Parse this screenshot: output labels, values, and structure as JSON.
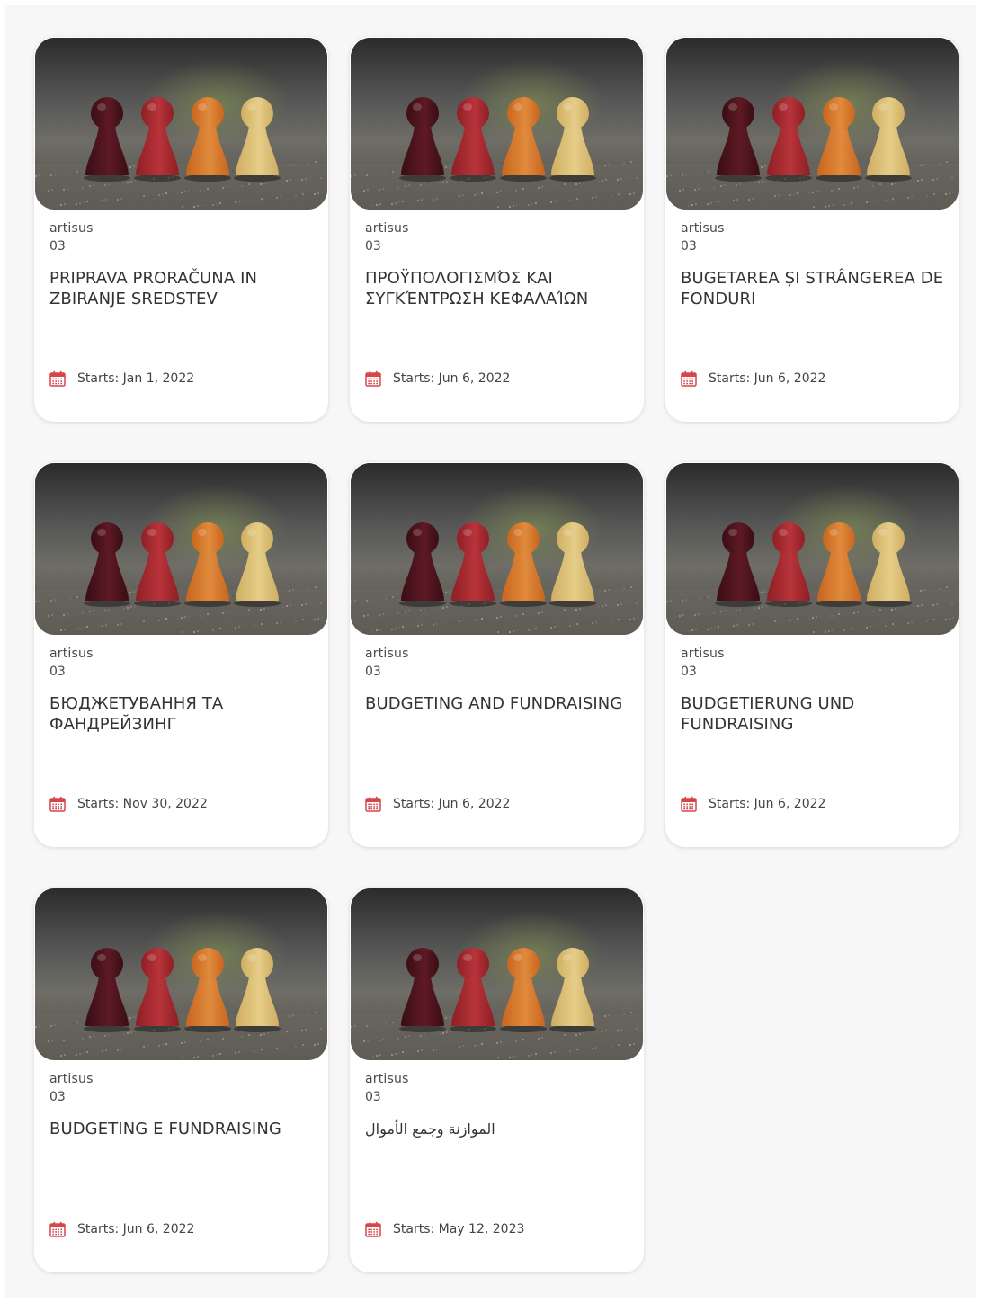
{
  "colors": {
    "page_background": "#f7f7f7",
    "card_background": "#ffffff",
    "calendar_icon": "#d6454a",
    "text": "#333333"
  },
  "icons": {
    "date": "calendar-icon",
    "thumbnail": "course-image"
  },
  "courses": [
    {
      "author": "artisus",
      "lessons": "03",
      "title": "PRIPRAVA PRORAČUNA IN ZBIRANJE SREDSTEV",
      "starts": "Starts: Jan 1, 2022"
    },
    {
      "author": "artisus",
      "lessons": "03",
      "title": "ΠΡΟΫΠΟΛΟΓΙΣΜΌΣ ΚΑΙ ΣΥΓΚΈΝΤΡΩΣΗ ΚΕΦΑΛΑΊΩΝ",
      "starts": "Starts: Jun 6, 2022"
    },
    {
      "author": "artisus",
      "lessons": "03",
      "title": "BUGETAREA ȘI STRÂNGEREA DE FONDURI",
      "starts": "Starts: Jun 6, 2022"
    },
    {
      "author": "artisus",
      "lessons": "03",
      "title": "БЮДЖЕТУВАННЯ ТА ФАНДРЕЙЗИНГ",
      "starts": "Starts: Nov 30, 2022"
    },
    {
      "author": "artisus",
      "lessons": "03",
      "title": "BUDGETING AND FUNDRAISING",
      "starts": "Starts: Jun 6, 2022"
    },
    {
      "author": "artisus",
      "lessons": "03",
      "title": "BUDGETIERUNG UND FUNDRAISING",
      "starts": "Starts: Jun 6, 2022"
    },
    {
      "author": "artisus",
      "lessons": "03",
      "title": "BUDGETING E FUNDRAISING",
      "starts": "Starts: Jun 6, 2022"
    },
    {
      "author": "artisus",
      "lessons": "03",
      "title": "الموازنة وجمع الأموال",
      "starts": "Starts: May 12, 2023"
    }
  ]
}
